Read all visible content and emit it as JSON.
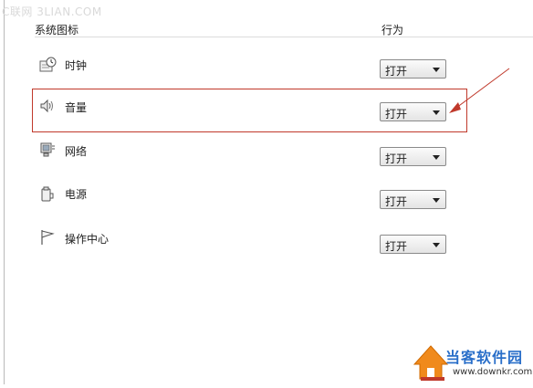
{
  "watermark": "C联网 3LIAN.COM",
  "headers": {
    "icons": "系统图标",
    "behavior": "行为"
  },
  "rows": [
    {
      "label": "时钟",
      "icon": "clock-icon",
      "value": "打开"
    },
    {
      "label": "音量",
      "icon": "volume-icon",
      "value": "打开"
    },
    {
      "label": "网络",
      "icon": "network-icon",
      "value": "打开"
    },
    {
      "label": "电源",
      "icon": "power-icon",
      "value": "打开"
    },
    {
      "label": "操作中心",
      "icon": "flag-icon",
      "value": "打开"
    }
  ],
  "highlighted_row": "音量",
  "brand": {
    "name": "当客软件园",
    "url": "www.downkr.com",
    "colors": {
      "name": "#2a6fc9",
      "house": "#f08a1c"
    }
  },
  "colors": {
    "highlight": "#c0392b"
  }
}
